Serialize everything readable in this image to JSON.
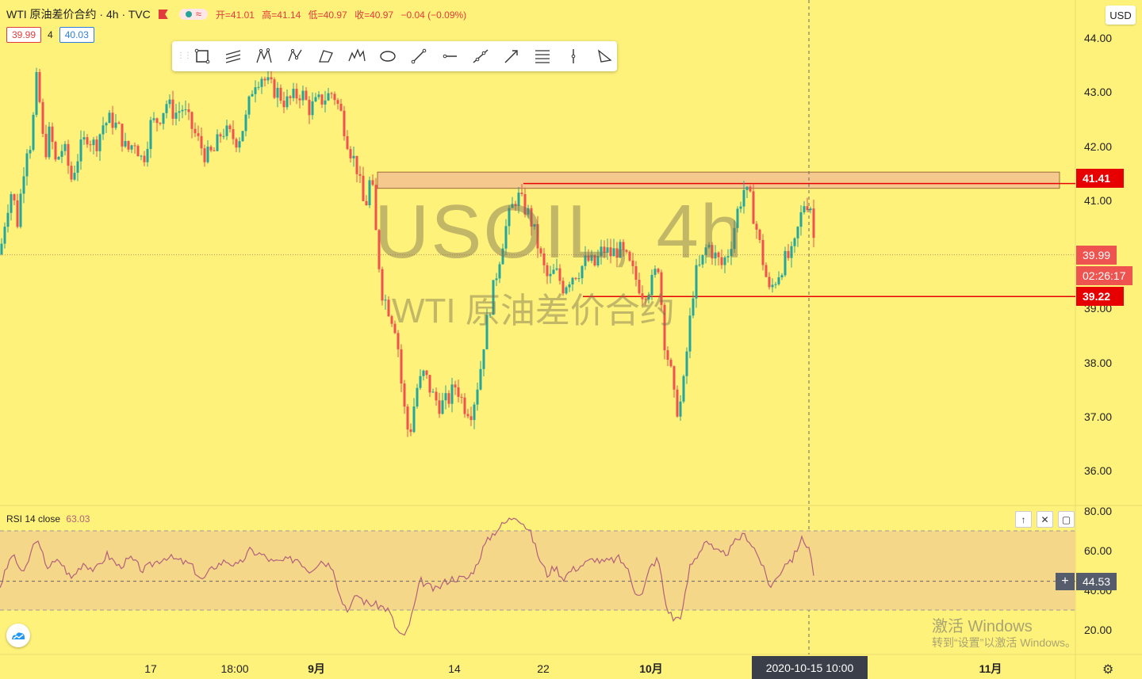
{
  "header": {
    "symbol_title": "WTI 原油差价合约 · 4h · TVC",
    "ohlc": {
      "open": "开=41.01",
      "high": "高=41.14",
      "low": "低=40.97",
      "close": "收=40.97",
      "change": "−0.04 (−0.09%)"
    },
    "bid": "39.99",
    "spread": "4",
    "ask": "40.03",
    "currency": "USD"
  },
  "drawing_toolbar": {
    "tools": [
      "rectangle-icon",
      "parallel-channel-icon",
      "xabcd-pattern-icon",
      "abcd-pattern-icon",
      "triangle-pattern-icon",
      "elliott-wave-icon",
      "ellipse-icon",
      "trend-line-icon",
      "horizontal-ray-icon",
      "extended-line-icon",
      "arrow-line-icon",
      "fib-retracement-icon",
      "vertical-line-icon",
      "polyline-icon"
    ]
  },
  "watermark": {
    "main": "USOIL, 4h",
    "sub": "WTI 原油差价合约"
  },
  "price_axis": {
    "ticks": [
      "44.00",
      "43.00",
      "42.00",
      "41.00",
      "39.00",
      "38.00",
      "37.00",
      "36.00"
    ],
    "tags": {
      "resistance": "41.41",
      "last": "39.99",
      "countdown": "02:26:17",
      "support": "39.22"
    }
  },
  "rsi": {
    "label": "RSI 14 close",
    "value": "63.03",
    "axis_ticks": [
      "80.00",
      "60.00",
      "40.00",
      "20.00"
    ],
    "crosshair_value": "44.53",
    "ctrl_up": "↑",
    "ctrl_close": "✕",
    "ctrl_max": "▢"
  },
  "time_axis": {
    "labels": [
      "17",
      "18:00",
      "9月",
      "14",
      "22",
      "10月",
      "11月"
    ],
    "crosshair_date": "2020-10-15   10:00"
  },
  "activation": {
    "line1": "激活 Windows",
    "line2": "转到“设置”以激活 Windows。"
  },
  "colors": {
    "background": "#fff27a",
    "up": "#26a69a",
    "down": "#ef5350",
    "level_line": "#e60000",
    "zone_fill": "#f5c98d",
    "rsi_line": "#b2607a",
    "rsi_band": "#f5d78a"
  },
  "chart_data": [
    {
      "type": "candlestick",
      "title": "USOIL, 4h",
      "ylim": [
        35.6,
        44.4
      ],
      "price_ticks": [
        44,
        43,
        42,
        41,
        39,
        38,
        37,
        36
      ],
      "x_labels": [
        "17",
        "18:00",
        "9月",
        "14",
        "22",
        "10月",
        "11月"
      ],
      "approx_close_path": [
        [
          0,
          40.0
        ],
        [
          8,
          40.8
        ],
        [
          15,
          41.2
        ],
        [
          22,
          40.6
        ],
        [
          30,
          41.6
        ],
        [
          35,
          42.1
        ],
        [
          40,
          42.0
        ],
        [
          45,
          43.3
        ],
        [
          50,
          42.8
        ],
        [
          56,
          41.8
        ],
        [
          63,
          42.3
        ],
        [
          70,
          41.7
        ],
        [
          80,
          42.0
        ],
        [
          90,
          41.4
        ],
        [
          100,
          41.9
        ],
        [
          110,
          42.2
        ],
        [
          120,
          42.0
        ],
        [
          130,
          42.4
        ],
        [
          140,
          42.5
        ],
        [
          150,
          42.3
        ],
        [
          160,
          41.9
        ],
        [
          170,
          42.1
        ],
        [
          180,
          41.7
        ],
        [
          190,
          42.4
        ],
        [
          200,
          42.5
        ],
        [
          210,
          42.8
        ],
        [
          220,
          42.6
        ],
        [
          230,
          42.7
        ],
        [
          240,
          42.4
        ],
        [
          250,
          42.1
        ],
        [
          260,
          41.8
        ],
        [
          270,
          41.9
        ],
        [
          280,
          42.3
        ],
        [
          290,
          42.2
        ],
        [
          300,
          42.1
        ],
        [
          310,
          42.5
        ],
        [
          320,
          43.2
        ],
        [
          330,
          43.3
        ],
        [
          340,
          43.1
        ],
        [
          350,
          43.0
        ],
        [
          360,
          42.8
        ],
        [
          370,
          42.9
        ],
        [
          380,
          43.0
        ],
        [
          390,
          42.7
        ],
        [
          400,
          42.8
        ],
        [
          410,
          42.9
        ],
        [
          420,
          43.0
        ],
        [
          430,
          42.6
        ],
        [
          440,
          42.0
        ],
        [
          450,
          41.6
        ],
        [
          460,
          40.8
        ],
        [
          468,
          41.5
        ],
        [
          475,
          40.2
        ],
        [
          482,
          39.3
        ],
        [
          490,
          39.0
        ],
        [
          500,
          38.6
        ],
        [
          508,
          37.3
        ],
        [
          516,
          36.6
        ],
        [
          525,
          37.5
        ],
        [
          535,
          37.8
        ],
        [
          545,
          37.4
        ],
        [
          555,
          37.2
        ],
        [
          565,
          37.3
        ],
        [
          575,
          37.6
        ],
        [
          585,
          37.2
        ],
        [
          595,
          37.1
        ],
        [
          605,
          37.8
        ],
        [
          612,
          38.6
        ],
        [
          620,
          39.2
        ],
        [
          628,
          39.8
        ],
        [
          636,
          40.4
        ],
        [
          644,
          40.8
        ],
        [
          652,
          41.1
        ],
        [
          660,
          40.9
        ],
        [
          668,
          40.7
        ],
        [
          676,
          40.3
        ],
        [
          684,
          39.8
        ],
        [
          692,
          39.5
        ],
        [
          700,
          39.7
        ],
        [
          710,
          39.4
        ],
        [
          720,
          39.6
        ],
        [
          730,
          39.7
        ],
        [
          740,
          39.9
        ],
        [
          750,
          39.8
        ],
        [
          760,
          40.1
        ],
        [
          770,
          40.0
        ],
        [
          780,
          40.1
        ],
        [
          790,
          39.9
        ],
        [
          800,
          39.6
        ],
        [
          810,
          39.3
        ],
        [
          820,
          39.4
        ],
        [
          830,
          39.8
        ],
        [
          838,
          38.4
        ],
        [
          846,
          37.8
        ],
        [
          852,
          37.1
        ],
        [
          860,
          37.3
        ],
        [
          868,
          38.5
        ],
        [
          876,
          39.6
        ],
        [
          884,
          39.8
        ],
        [
          892,
          40.2
        ],
        [
          900,
          40.0
        ],
        [
          910,
          39.8
        ],
        [
          920,
          40.1
        ],
        [
          930,
          40.8
        ],
        [
          938,
          41.2
        ],
        [
          946,
          41.0
        ],
        [
          955,
          40.4
        ],
        [
          963,
          39.8
        ],
        [
          970,
          39.3
        ],
        [
          980,
          39.6
        ],
        [
          990,
          39.9
        ],
        [
          1000,
          40.0
        ],
        [
          1008,
          40.6
        ],
        [
          1015,
          41.0
        ],
        [
          1022,
          40.9
        ],
        [
          1028,
          40.0
        ]
      ],
      "last_price": 39.99,
      "horizontal_levels": [
        41.41,
        39.22
      ],
      "resistance_zone": [
        41.25,
        41.55
      ]
    },
    {
      "type": "line",
      "title": "RSI 14 close",
      "ylim": [
        10,
        85
      ],
      "overbought": 70,
      "oversold": 30,
      "axis_ticks": [
        80,
        60,
        40,
        20
      ],
      "approx_path": [
        [
          0,
          42
        ],
        [
          15,
          58
        ],
        [
          30,
          48
        ],
        [
          45,
          66
        ],
        [
          60,
          52
        ],
        [
          75,
          55
        ],
        [
          90,
          46
        ],
        [
          105,
          54
        ],
        [
          120,
          50
        ],
        [
          135,
          58
        ],
        [
          150,
          52
        ],
        [
          165,
          56
        ],
        [
          180,
          50
        ],
        [
          195,
          54
        ],
        [
          210,
          57
        ],
        [
          225,
          55
        ],
        [
          240,
          53
        ],
        [
          255,
          45
        ],
        [
          270,
          52
        ],
        [
          285,
          55
        ],
        [
          300,
          52
        ],
        [
          315,
          60
        ],
        [
          330,
          58
        ],
        [
          345,
          54
        ],
        [
          360,
          55
        ],
        [
          375,
          56
        ],
        [
          390,
          50
        ],
        [
          405,
          55
        ],
        [
          420,
          52
        ],
        [
          430,
          35
        ],
        [
          440,
          30
        ],
        [
          450,
          38
        ],
        [
          460,
          34
        ],
        [
          470,
          33
        ],
        [
          480,
          32
        ],
        [
          490,
          30
        ],
        [
          500,
          20
        ],
        [
          510,
          16
        ],
        [
          520,
          28
        ],
        [
          530,
          45
        ],
        [
          540,
          42
        ],
        [
          550,
          40
        ],
        [
          560,
          44
        ],
        [
          570,
          46
        ],
        [
          580,
          46
        ],
        [
          590,
          46
        ],
        [
          600,
          52
        ],
        [
          610,
          62
        ],
        [
          620,
          68
        ],
        [
          630,
          72
        ],
        [
          640,
          75
        ],
        [
          650,
          78
        ],
        [
          660,
          74
        ],
        [
          670,
          68
        ],
        [
          680,
          56
        ],
        [
          690,
          48
        ],
        [
          700,
          52
        ],
        [
          710,
          46
        ],
        [
          720,
          50
        ],
        [
          730,
          52
        ],
        [
          740,
          54
        ],
        [
          750,
          56
        ],
        [
          760,
          54
        ],
        [
          770,
          55
        ],
        [
          780,
          56
        ],
        [
          790,
          52
        ],
        [
          800,
          40
        ],
        [
          810,
          38
        ],
        [
          820,
          52
        ],
        [
          830,
          56
        ],
        [
          840,
          32
        ],
        [
          850,
          25
        ],
        [
          860,
          28
        ],
        [
          870,
          52
        ],
        [
          880,
          58
        ],
        [
          890,
          66
        ],
        [
          900,
          60
        ],
        [
          910,
          58
        ],
        [
          920,
          60
        ],
        [
          930,
          66
        ],
        [
          940,
          68
        ],
        [
          950,
          62
        ],
        [
          960,
          54
        ],
        [
          970,
          42
        ],
        [
          980,
          46
        ],
        [
          990,
          54
        ],
        [
          1000,
          56
        ],
        [
          1010,
          66
        ],
        [
          1020,
          62
        ],
        [
          1028,
          44
        ]
      ],
      "last_value": 63.03,
      "crosshair_value": 44.53
    }
  ]
}
